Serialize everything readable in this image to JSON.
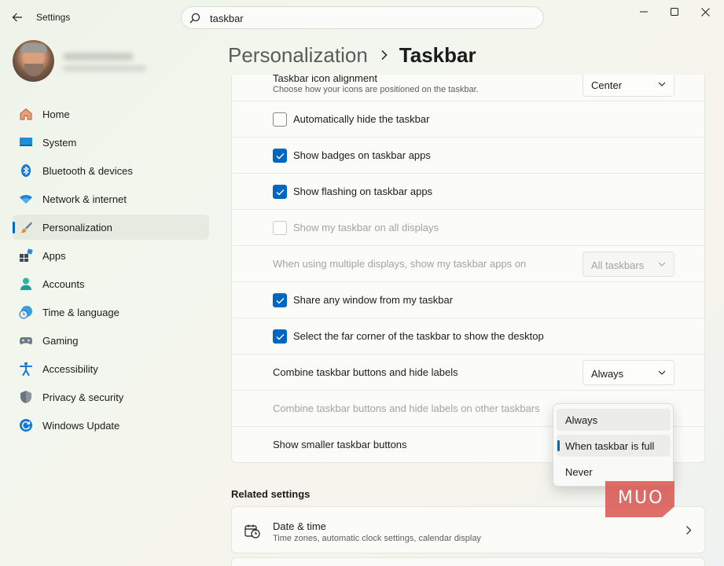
{
  "window": {
    "app_title": "Settings"
  },
  "search": {
    "value": "taskbar"
  },
  "nav": {
    "items": [
      {
        "label": "Home",
        "icon": "home-icon"
      },
      {
        "label": "System",
        "icon": "system-icon"
      },
      {
        "label": "Bluetooth & devices",
        "icon": "bluetooth-icon"
      },
      {
        "label": "Network & internet",
        "icon": "wifi-icon"
      },
      {
        "label": "Personalization",
        "icon": "brush-icon",
        "active": true
      },
      {
        "label": "Apps",
        "icon": "apps-icon"
      },
      {
        "label": "Accounts",
        "icon": "account-icon"
      },
      {
        "label": "Time & language",
        "icon": "globe-clock-icon"
      },
      {
        "label": "Gaming",
        "icon": "gamepad-icon"
      },
      {
        "label": "Accessibility",
        "icon": "accessibility-icon"
      },
      {
        "label": "Privacy & security",
        "icon": "shield-icon"
      },
      {
        "label": "Windows Update",
        "icon": "update-icon"
      }
    ]
  },
  "breadcrumb": {
    "parent": "Personalization",
    "current": "Taskbar"
  },
  "settings": {
    "alignment": {
      "title": "Taskbar icon alignment",
      "subtitle": "Choose how your icons are positioned on the taskbar.",
      "value": "Center"
    },
    "rows": [
      {
        "label": "Automatically hide the taskbar",
        "checked": false,
        "disabled": false
      },
      {
        "label": "Show badges on taskbar apps",
        "checked": true,
        "disabled": false
      },
      {
        "label": "Show flashing on taskbar apps",
        "checked": true,
        "disabled": false
      },
      {
        "label": "Show my taskbar on all displays",
        "checked": false,
        "disabled": true
      }
    ],
    "multi_display": {
      "label": "When using multiple displays, show my taskbar apps on",
      "value": "All taskbars",
      "disabled": true
    },
    "rows2": [
      {
        "label": "Share any window from my taskbar",
        "checked": true,
        "disabled": false
      },
      {
        "label": "Select the far corner of the taskbar to show the desktop",
        "checked": true,
        "disabled": false
      }
    ],
    "combine": {
      "label": "Combine taskbar buttons and hide labels",
      "value": "Always"
    },
    "combine_other": {
      "label": "Combine taskbar buttons and hide labels on other taskbars",
      "disabled": true
    },
    "smaller": {
      "label": "Show smaller taskbar buttons"
    }
  },
  "popup": {
    "options": [
      "Always",
      "When taskbar is full",
      "Never"
    ],
    "hovered_index": 0,
    "selected_index": 1
  },
  "related": {
    "heading": "Related settings",
    "date_time": {
      "title": "Date & time",
      "subtitle": "Time zones, automatic clock settings, calendar display"
    }
  },
  "watermark": {
    "text": "MUO"
  },
  "colors": {
    "accent": "#0067c0",
    "watermark": "#d9534f"
  }
}
